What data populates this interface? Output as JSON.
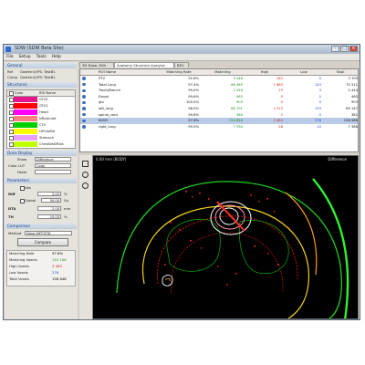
{
  "window": {
    "title": "SDW (SDW Beta Site)",
    "menu": [
      "File",
      "Setup",
      "Tools",
      "Help"
    ]
  },
  "general": {
    "header": "General",
    "ref_label": "Ref",
    "ref_value": "Gosfern\\OPS: TestB1",
    "comp_label": "Comp",
    "comp_value": "Gosfern\\OPS: TestB1"
  },
  "structures": {
    "header": "Structures",
    "col_color": "Color",
    "col_name": "ROI Name",
    "items": [
      {
        "name": "GTV0",
        "color": "#e4178a"
      },
      {
        "name": "GTV1",
        "color": "#ff0000"
      },
      {
        "name": "Heart",
        "color": "#ff00ff"
      },
      {
        "name": "NRvsbulet",
        "color": "#ff8080"
      },
      {
        "name": "CTV",
        "color": "#00d000"
      },
      {
        "name": "LtPulmBd",
        "color": "#ffff00"
      },
      {
        "name": "Stomach",
        "color": "#e8a0ff"
      },
      {
        "name": "ChestWall/Ribs",
        "color": "#c0ff00"
      }
    ]
  },
  "dose_display": {
    "header": "Dose Display",
    "show_label": "Show",
    "show_value": "Difference",
    "color_lut_label": "Color LUT",
    "color_lut_value": "Color",
    "fader_label": "Fader"
  },
  "parameters": {
    "header": "Parameters",
    "abs_label": "Abs",
    "diff_label": "Diff",
    "diff_value": "2.00",
    "diff_unit": "%",
    "global_label": "Global",
    "global_value": "50.00",
    "global_unit": "Gy",
    "dta_label": "DTA",
    "dta_value": "2.00",
    "dta_unit": "mm",
    "th_label": "TH",
    "th_value": "10.00",
    "th_unit": "%"
  },
  "comparison": {
    "header": "Comparison",
    "method_label": "Method",
    "method_value": "Dose DIFF/DTA",
    "compare_button": "Compare",
    "results": [
      {
        "label": "Matching Rate",
        "value": "97.6%",
        "color": "#000000"
      },
      {
        "label": "Matching Voxels",
        "value": "153 108",
        "color": "#1f8a1f"
      },
      {
        "label": "High Voxels",
        "value": "3 464",
        "color": "#d81b1b"
      },
      {
        "label": "Low Voxels",
        "value": "276",
        "color": "#1b3fd8"
      },
      {
        "label": "Total Voxels",
        "value": "158 848",
        "color": "#000000"
      }
    ]
  },
  "tabs": [
    "3D Dose, DVh",
    "Anatomy Structure Analysis",
    "BEV"
  ],
  "table": {
    "headers": [
      "ROI Name",
      "Matching Rate",
      "Matching",
      "High",
      "Low",
      "Total"
    ],
    "rows": [
      {
        "name": "PTV",
        "rate": "92.8%",
        "matching": "3 446",
        "high": "263",
        "low": "0",
        "total": "3 709"
      },
      {
        "name": "Total Lung",
        "rate": "97.4%",
        "matching": "68 485",
        "high": "1 683",
        "low": "143",
        "total": "70 311"
      },
      {
        "name": "Trach/Bronch",
        "rate": "99.0%",
        "matching": "2 418",
        "high": "23",
        "low": "3",
        "total": "2 444"
      },
      {
        "name": "Esoph",
        "rate": "99.6%",
        "matching": "463",
        "high": "0",
        "low": "2",
        "total": "465"
      },
      {
        "name": "gtv",
        "rate": "100.0%",
        "matching": "903",
        "high": "0",
        "low": "0",
        "total": "903"
      },
      {
        "name": "left_lung",
        "rate": "96.5%",
        "matching": "66 701",
        "high": "2 313",
        "low": "133",
        "total": "69 147"
      },
      {
        "name": "spinal_cord",
        "rate": "99.6%",
        "matching": "380",
        "high": "2",
        "low": "0",
        "total": "382"
      },
      {
        "name": "BODY",
        "rate": "97.6%",
        "matching": "154 846",
        "high": "3 464",
        "low": "278",
        "total": "158 588"
      },
      {
        "name": "right_lung",
        "rate": "99.5%",
        "matching": "7 330",
        "high": "28",
        "low": "10",
        "total": "7 368"
      }
    ]
  },
  "viewer": {
    "slice_label": "0.00 mm (BODY)",
    "mode_label": "Difference"
  },
  "colors": {
    "matching": "#1f8a1f",
    "high": "#d81b1b",
    "low": "#1b3fd8",
    "section_header": "#1a3d7a"
  }
}
